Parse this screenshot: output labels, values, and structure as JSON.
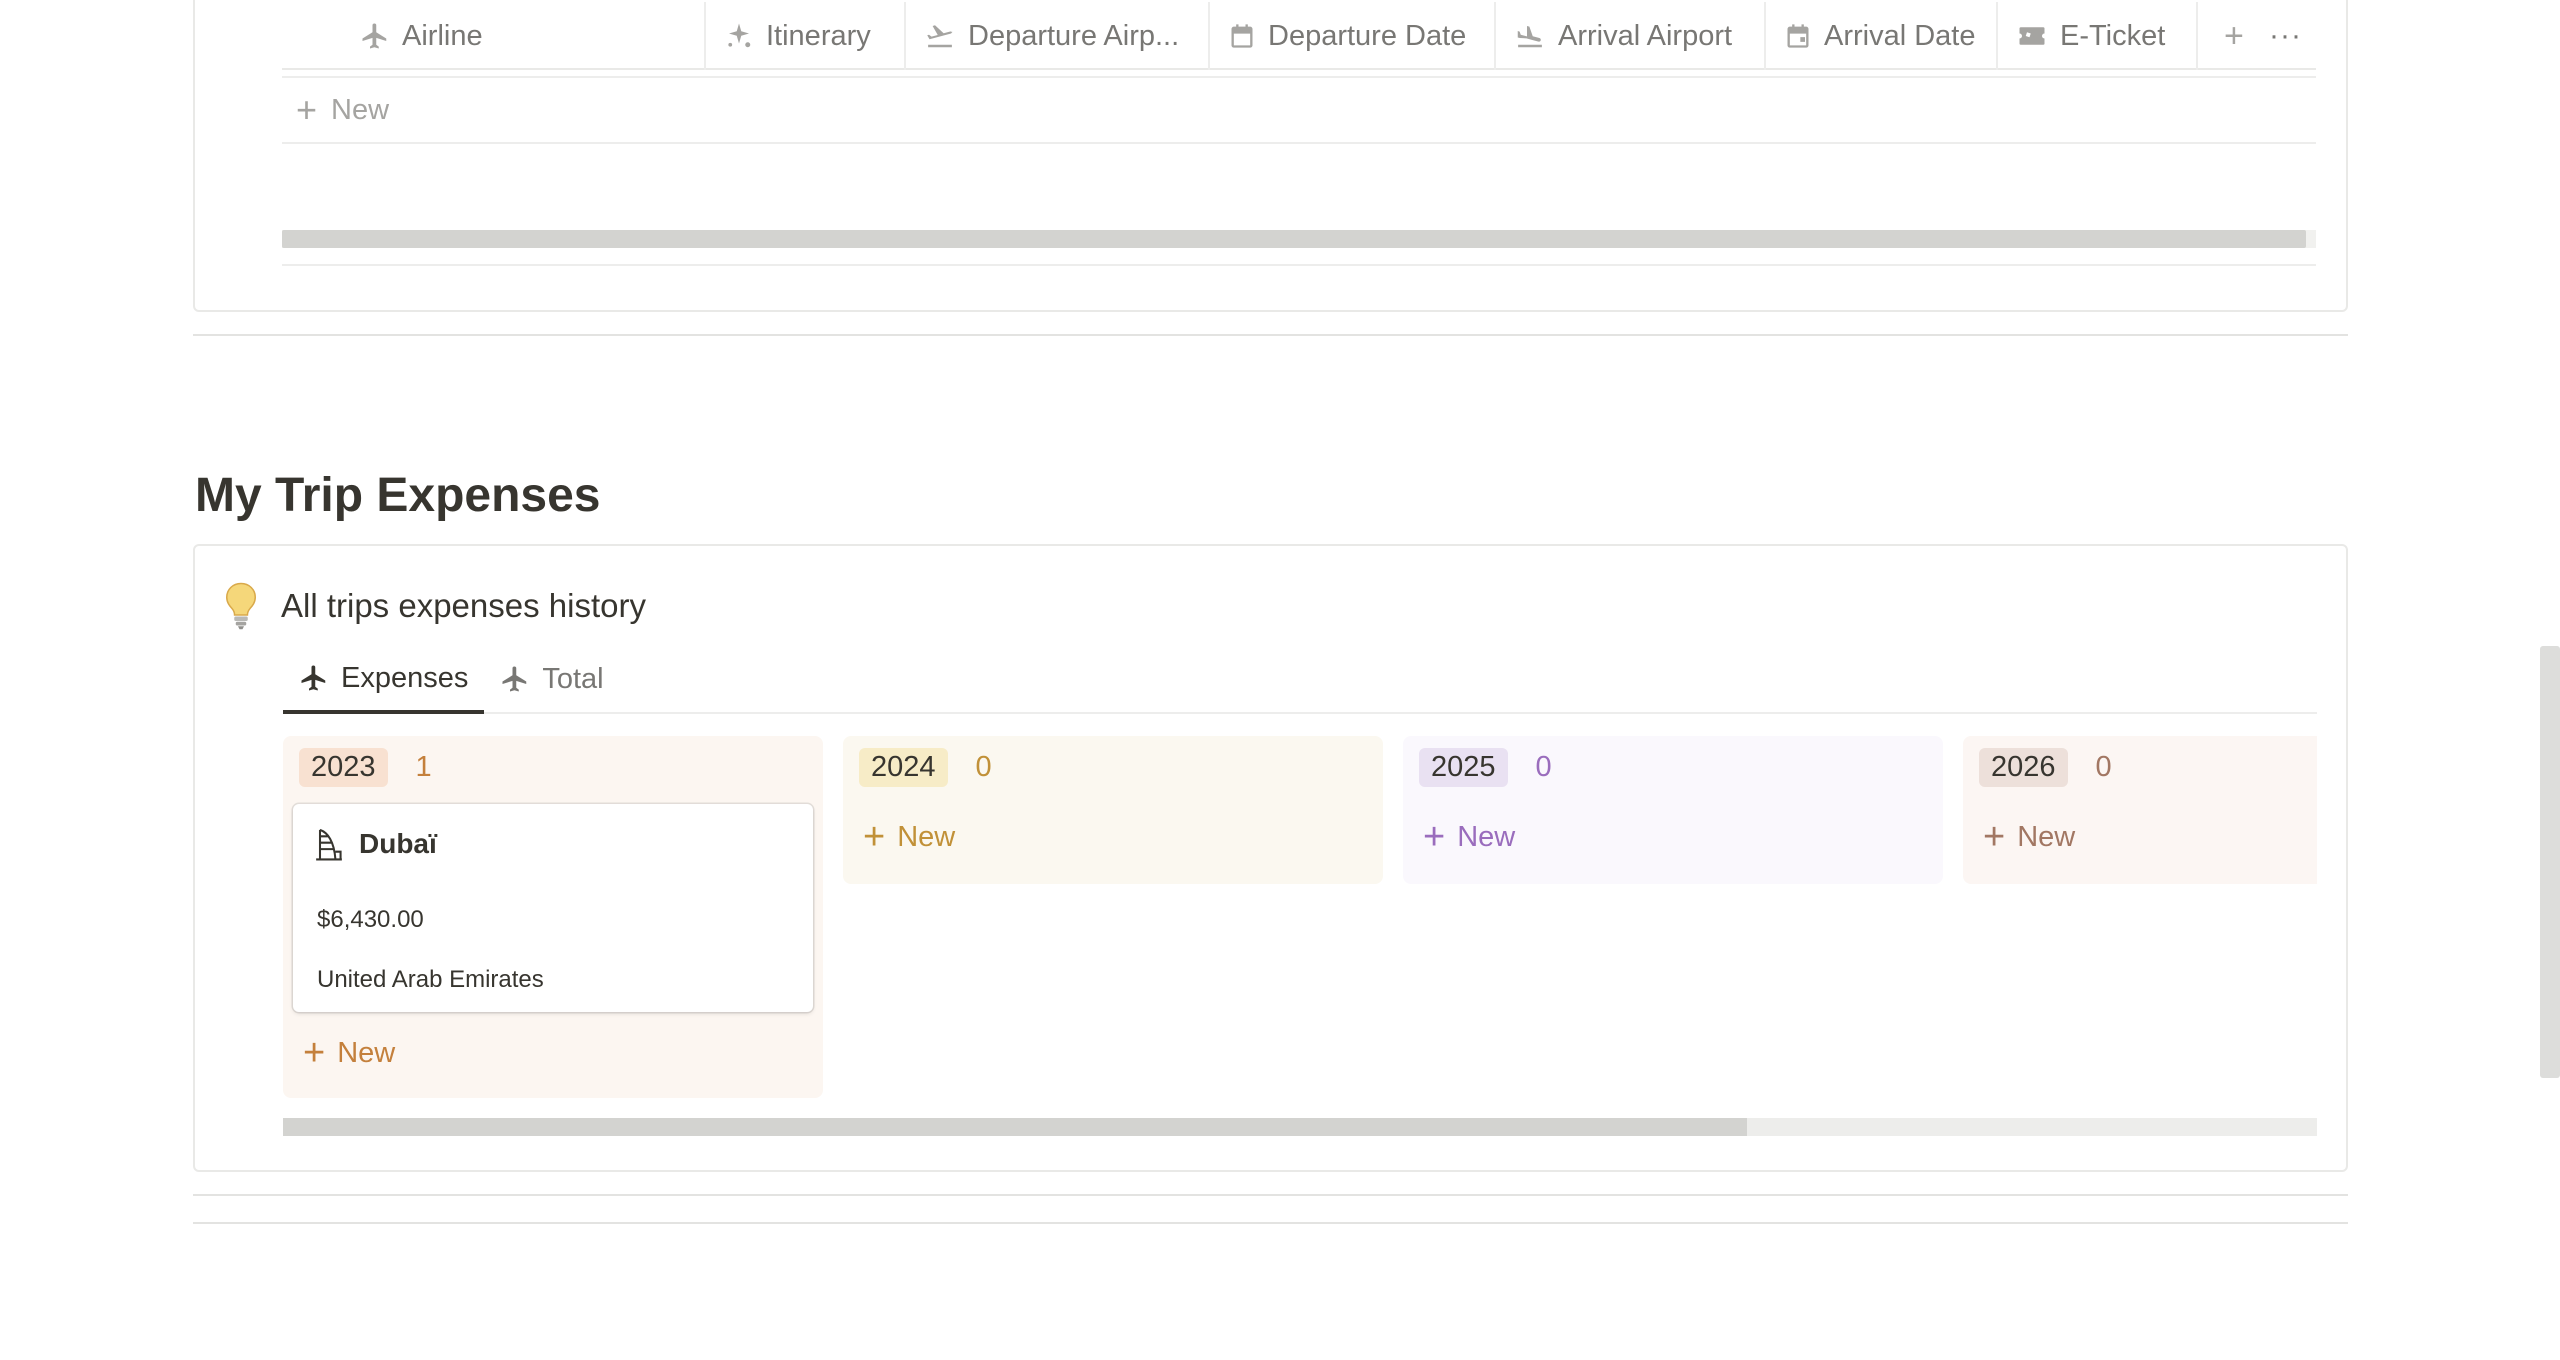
{
  "flights_table": {
    "columns": [
      {
        "label": "Airline",
        "icon": "airplane-icon"
      },
      {
        "label": "Itinerary",
        "icon": "sparkle-icon"
      },
      {
        "label": "Departure Airp...",
        "icon": "takeoff-icon"
      },
      {
        "label": "Departure Date",
        "icon": "calendar-icon"
      },
      {
        "label": "Arrival Airport",
        "icon": "landing-icon"
      },
      {
        "label": "Arrival Date",
        "icon": "calendar-icon"
      },
      {
        "label": "E-Ticket",
        "icon": "ticket-icon"
      }
    ],
    "add_column_label": "+",
    "more_label": "···",
    "new_row_label": "New",
    "scroll_fraction_visible": 0.995
  },
  "section": {
    "title": "My Trip Expenses"
  },
  "expenses": {
    "callout_icon": "lightbulb-icon",
    "callout_text": "All trips expenses history",
    "tabs": [
      {
        "label": "Expenses",
        "icon": "airplane-icon",
        "active": true
      },
      {
        "label": "Total",
        "icon": "airplane-icon",
        "active": false
      }
    ],
    "columns": [
      {
        "year": "2023",
        "count": "1",
        "new_label": "New",
        "cards": [
          {
            "title": "Dubaï",
            "icon": "burj-al-arab-icon",
            "amount": "$6,430.00",
            "country": "United Arab Emirates"
          }
        ]
      },
      {
        "year": "2024",
        "count": "0",
        "new_label": "New",
        "cards": []
      },
      {
        "year": "2025",
        "count": "0",
        "new_label": "New",
        "cards": []
      },
      {
        "year": "2026",
        "count": "0",
        "new_label": "New",
        "cards": []
      }
    ],
    "scroll_fraction_visible": 0.72
  },
  "colors": {
    "text": "#37352f",
    "muted": "#787774",
    "year_2023": "#c4803c",
    "year_2024": "#c19138",
    "year_2025": "#9a6dbd",
    "year_2026": "#a27763"
  }
}
